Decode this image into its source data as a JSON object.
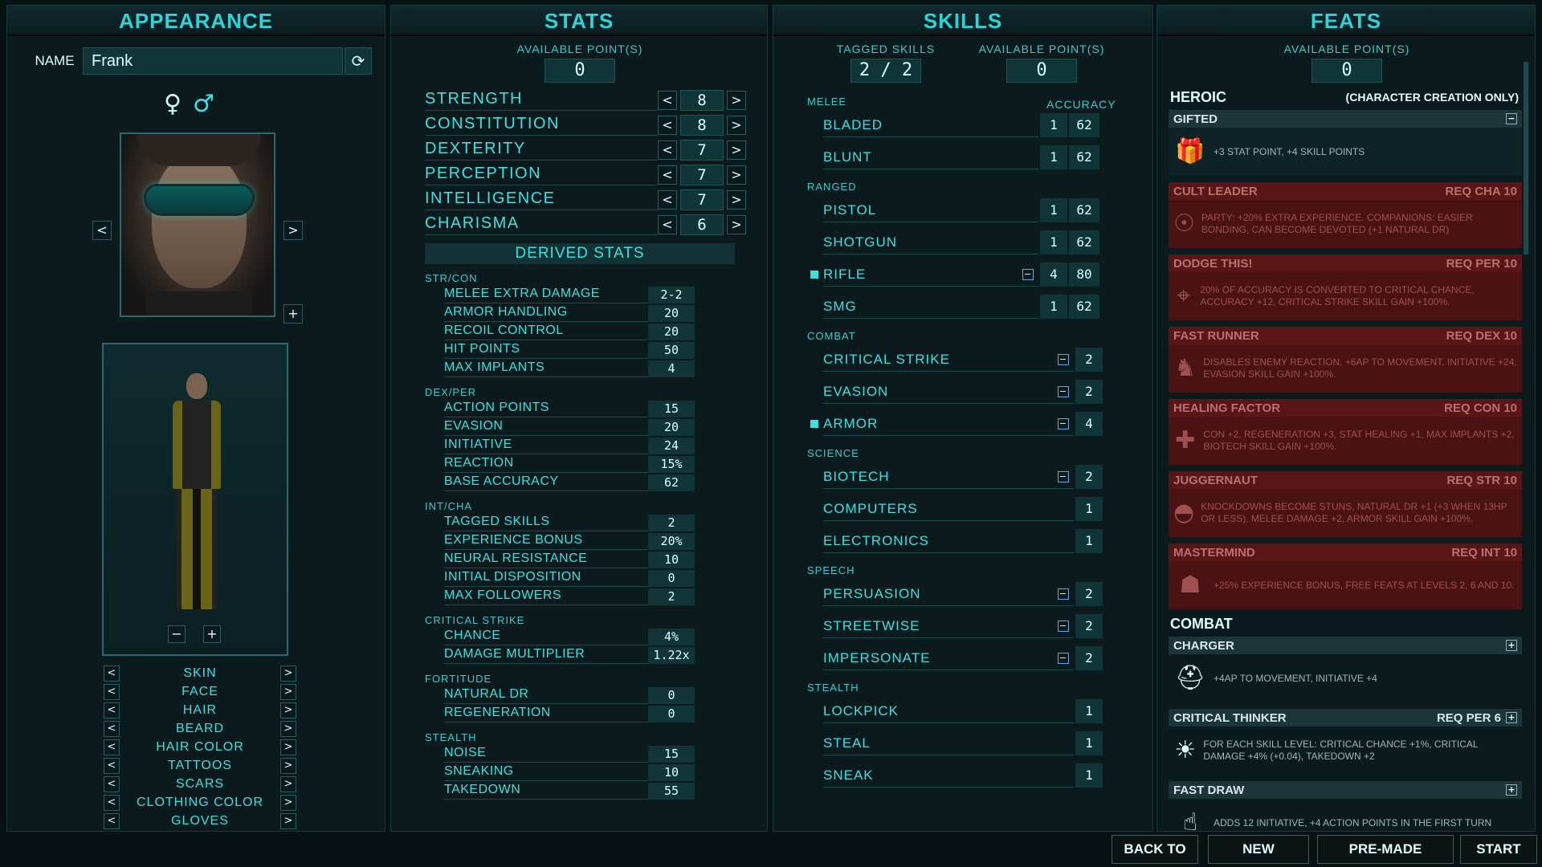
{
  "appearance": {
    "title": "APPEARANCE",
    "name_label": "NAME",
    "name_value": "Frank",
    "refresh_glyph": "⟳",
    "female_glyph": "♀",
    "male_glyph": "♂",
    "customization": [
      "SKIN",
      "FACE",
      "HAIR",
      "BEARD",
      "HAIR COLOR",
      "TATTOOS",
      "SCARS",
      "CLOTHING COLOR",
      "GLOVES"
    ]
  },
  "stats": {
    "title": "STATS",
    "available_label": "AVAILABLE POINT(S)",
    "available_value": "0",
    "attributes": [
      {
        "name": "STRENGTH",
        "value": "8"
      },
      {
        "name": "CONSTITUTION",
        "value": "8"
      },
      {
        "name": "DEXTERITY",
        "value": "7"
      },
      {
        "name": "PERCEPTION",
        "value": "7"
      },
      {
        "name": "INTELLIGENCE",
        "value": "7"
      },
      {
        "name": "CHARISMA",
        "value": "6"
      }
    ],
    "derived_title": "DERIVED STATS",
    "groups": [
      {
        "label": "STR/CON",
        "rows": [
          {
            "name": "MELEE EXTRA DAMAGE",
            "value": "2-2"
          },
          {
            "name": "ARMOR HANDLING",
            "value": "20"
          },
          {
            "name": "RECOIL CONTROL",
            "value": "20"
          },
          {
            "name": "HIT POINTS",
            "value": "50"
          },
          {
            "name": "MAX IMPLANTS",
            "value": "4"
          }
        ]
      },
      {
        "label": "DEX/PER",
        "rows": [
          {
            "name": "ACTION POINTS",
            "value": "15"
          },
          {
            "name": "EVASION",
            "value": "20"
          },
          {
            "name": "INITIATIVE",
            "value": "24"
          },
          {
            "name": "REACTION",
            "value": "15%"
          },
          {
            "name": "BASE ACCURACY",
            "value": "62"
          }
        ]
      },
      {
        "label": "INT/CHA",
        "rows": [
          {
            "name": "TAGGED SKILLS",
            "value": "2"
          },
          {
            "name": "EXPERIENCE BONUS",
            "value": "20%"
          },
          {
            "name": "NEURAL RESISTANCE",
            "value": "10"
          },
          {
            "name": "INITIAL DISPOSITION",
            "value": "0"
          },
          {
            "name": "MAX FOLLOWERS",
            "value": "2"
          }
        ]
      },
      {
        "label": "CRITICAL STRIKE",
        "rows": [
          {
            "name": "CHANCE",
            "value": "4%"
          },
          {
            "name": "DAMAGE MULTIPLIER",
            "value": "1.22x"
          }
        ]
      },
      {
        "label": "FORTITUDE",
        "rows": [
          {
            "name": "NATURAL DR",
            "value": "0"
          },
          {
            "name": "REGENERATION",
            "value": "0"
          }
        ]
      },
      {
        "label": "STEALTH",
        "rows": [
          {
            "name": "NOISE",
            "value": "15"
          },
          {
            "name": "SNEAKING",
            "value": "10"
          },
          {
            "name": "TAKEDOWN",
            "value": "55"
          }
        ]
      }
    ]
  },
  "skills": {
    "title": "SKILLS",
    "tagged_label": "TAGGED SKILLS",
    "tagged_value": "2 / 2",
    "available_label": "AVAILABLE POINT(S)",
    "available_value": "0",
    "accuracy_label": "ACCURACY",
    "categories": [
      {
        "label": "MELEE",
        "skills": [
          {
            "name": "BLADED",
            "level": "1",
            "accuracy": "62",
            "tagged": false,
            "minus": false
          },
          {
            "name": "BLUNT",
            "level": "1",
            "accuracy": "62",
            "tagged": false,
            "minus": false
          }
        ]
      },
      {
        "label": "RANGED",
        "skills": [
          {
            "name": "PISTOL",
            "level": "1",
            "accuracy": "62",
            "tagged": false,
            "minus": false
          },
          {
            "name": "SHOTGUN",
            "level": "1",
            "accuracy": "62",
            "tagged": false,
            "minus": false
          },
          {
            "name": "RIFLE",
            "level": "4",
            "accuracy": "80",
            "tagged": true,
            "minus": true
          },
          {
            "name": "SMG",
            "level": "1",
            "accuracy": "62",
            "tagged": false,
            "minus": false
          }
        ]
      },
      {
        "label": "COMBAT",
        "skills": [
          {
            "name": "CRITICAL STRIKE",
            "level": "2",
            "tagged": false,
            "minus": true
          },
          {
            "name": "EVASION",
            "level": "2",
            "tagged": false,
            "minus": true
          },
          {
            "name": "ARMOR",
            "level": "4",
            "tagged": true,
            "minus": true
          }
        ]
      },
      {
        "label": "SCIENCE",
        "skills": [
          {
            "name": "BIOTECH",
            "level": "2",
            "tagged": false,
            "minus": true
          },
          {
            "name": "COMPUTERS",
            "level": "1",
            "tagged": false,
            "minus": false
          },
          {
            "name": "ELECTRONICS",
            "level": "1",
            "tagged": false,
            "minus": false
          }
        ]
      },
      {
        "label": "SPEECH",
        "skills": [
          {
            "name": "PERSUASION",
            "level": "2",
            "tagged": false,
            "minus": true
          },
          {
            "name": "STREETWISE",
            "level": "2",
            "tagged": false,
            "minus": true
          },
          {
            "name": "IMPERSONATE",
            "level": "2",
            "tagged": false,
            "minus": true
          }
        ]
      },
      {
        "label": "STEALTH",
        "skills": [
          {
            "name": "LOCKPICK",
            "level": "1",
            "tagged": false,
            "minus": false
          },
          {
            "name": "STEAL",
            "level": "1",
            "tagged": false,
            "minus": false
          },
          {
            "name": "SNEAK",
            "level": "1",
            "tagged": false,
            "minus": false
          }
        ]
      }
    ]
  },
  "feats": {
    "title": "FEATS",
    "available_label": "AVAILABLE POINT(S)",
    "available_value": "0",
    "heroic_label": "HEROIC",
    "heroic_note": "(CHARACTER CREATION ONLY)",
    "combat_label": "COMBAT",
    "heroic": [
      {
        "name": "GIFTED",
        "req": "",
        "desc": "+3 STAT POINT, +4 SKILL POINTS",
        "state": "owned",
        "btn": "−",
        "icon": "gift-icon",
        "glyph": "🎁"
      },
      {
        "name": "CULT LEADER",
        "req": "REQ CHA 10",
        "desc": "PARTY: +20% EXTRA EXPERIENCE. COMPANIONS: EASIER BONDING, CAN BECOME DEVOTED (+1 NATURAL DR)",
        "state": "locked",
        "btn": "",
        "icon": "group-icon",
        "glyph": "☉"
      },
      {
        "name": "DODGE THIS!",
        "req": "REQ PER 10",
        "desc": "20% OF ACCURACY IS CONVERTED TO CRITICAL CHANCE, ACCURACY +12, CRITICAL STRIKE SKILL GAIN +100%.",
        "state": "locked",
        "btn": "",
        "icon": "crosshair-icon",
        "glyph": "⌖"
      },
      {
        "name": "FAST RUNNER",
        "req": "REQ DEX 10",
        "desc": "DISABLES ENEMY REACTION, +6AP TO MOVEMENT, INITIATIVE +24, EVASION SKILL GAIN +100%.",
        "state": "locked",
        "btn": "",
        "icon": "runner-icon",
        "glyph": "♞"
      },
      {
        "name": "HEALING FACTOR",
        "req": "REQ CON 10",
        "desc": "CON +2, REGENERATION +3, STAT HEALING +1, MAX IMPLANTS +2, BIOTECH SKILL GAIN +100%.",
        "state": "locked",
        "btn": "",
        "icon": "plus-icon",
        "glyph": "✚"
      },
      {
        "name": "JUGGERNAUT",
        "req": "REQ STR 10",
        "desc": "KNOCKDOWNS BECOME STUNS, NATURAL DR +1 (+3 WHEN 13HP OR LESS), MELEE DAMAGE +2, ARMOR SKILL GAIN +100%.",
        "state": "locked",
        "btn": "",
        "icon": "helmet-icon",
        "glyph": "◓"
      },
      {
        "name": "MASTERMIND",
        "req": "REQ INT 10",
        "desc": "+25% EXPERIENCE BONUS, FREE FEATS AT LEVELS 2, 6 AND 10.",
        "state": "locked",
        "btn": "",
        "icon": "brain-icon",
        "glyph": "☗"
      }
    ],
    "combat": [
      {
        "name": "CHARGER",
        "req": "",
        "desc": "+4AP TO MOVEMENT, INITIATIVE +4",
        "state": "available",
        "btn": "+",
        "icon": "football-helmet-icon",
        "glyph": "⛑"
      },
      {
        "name": "CRITICAL THINKER",
        "req": "REQ PER 6",
        "desc": "FOR EACH SKILL LEVEL: CRITICAL CHANCE +1%, CRITICAL DAMAGE +4% (+0.04), TAKEDOWN +2",
        "state": "available",
        "btn": "+",
        "icon": "lightbulb-icon",
        "glyph": "☀"
      },
      {
        "name": "FAST DRAW",
        "req": "",
        "desc": "ADDS 12 INITIATIVE, +4 ACTION POINTS IN THE FIRST TURN",
        "state": "available",
        "btn": "+",
        "icon": "hand-icon",
        "glyph": "☝"
      }
    ]
  },
  "buttons": {
    "back": "BACK TO MENU",
    "new": "NEW CHARACTER",
    "premade": "PRE-MADE CHARACTER",
    "start": "START GAME"
  }
}
